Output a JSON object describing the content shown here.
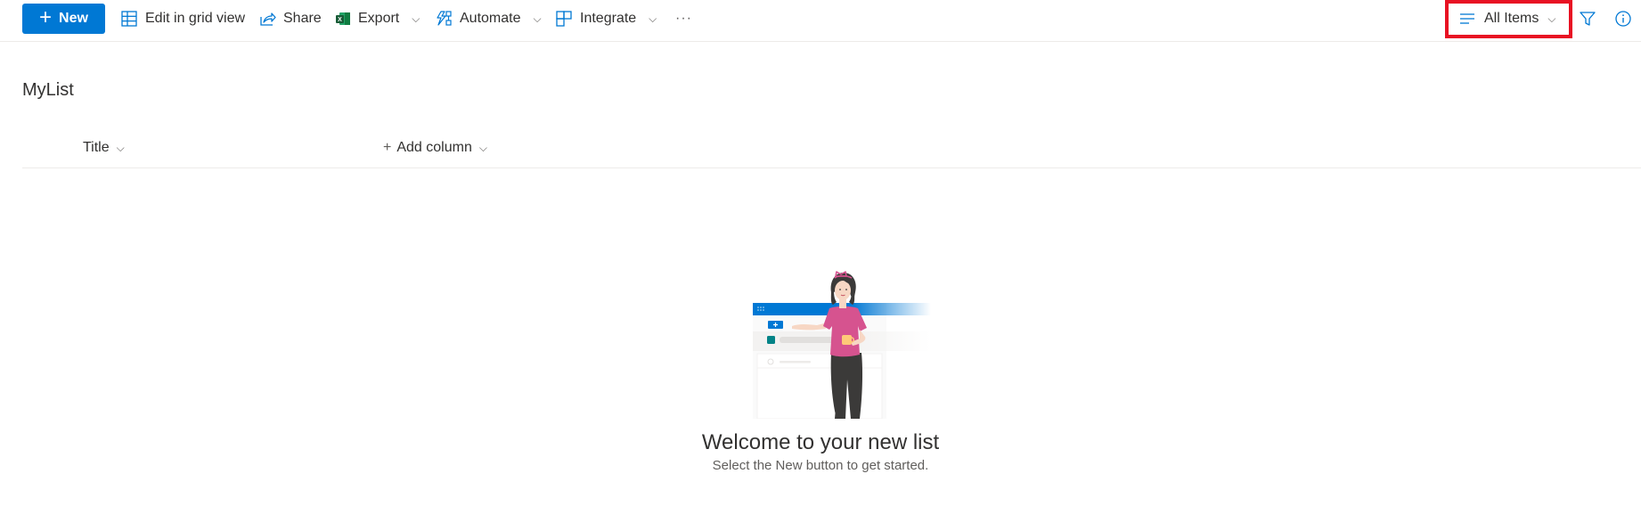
{
  "toolbar": {
    "new_label": "New",
    "edit_grid_label": "Edit in grid view",
    "share_label": "Share",
    "export_label": "Export",
    "automate_label": "Automate",
    "integrate_label": "Integrate",
    "more_label": "···",
    "view_label": "All Items",
    "accent": "#0078d4",
    "highlight": "#e81123"
  },
  "list": {
    "title": "MyList",
    "columns": [
      {
        "label": "Title"
      },
      {
        "label": "Add column",
        "prefix": "+"
      }
    ]
  },
  "empty_state": {
    "title": "Welcome to your new list",
    "subtitle": "Select the New button to get started."
  }
}
